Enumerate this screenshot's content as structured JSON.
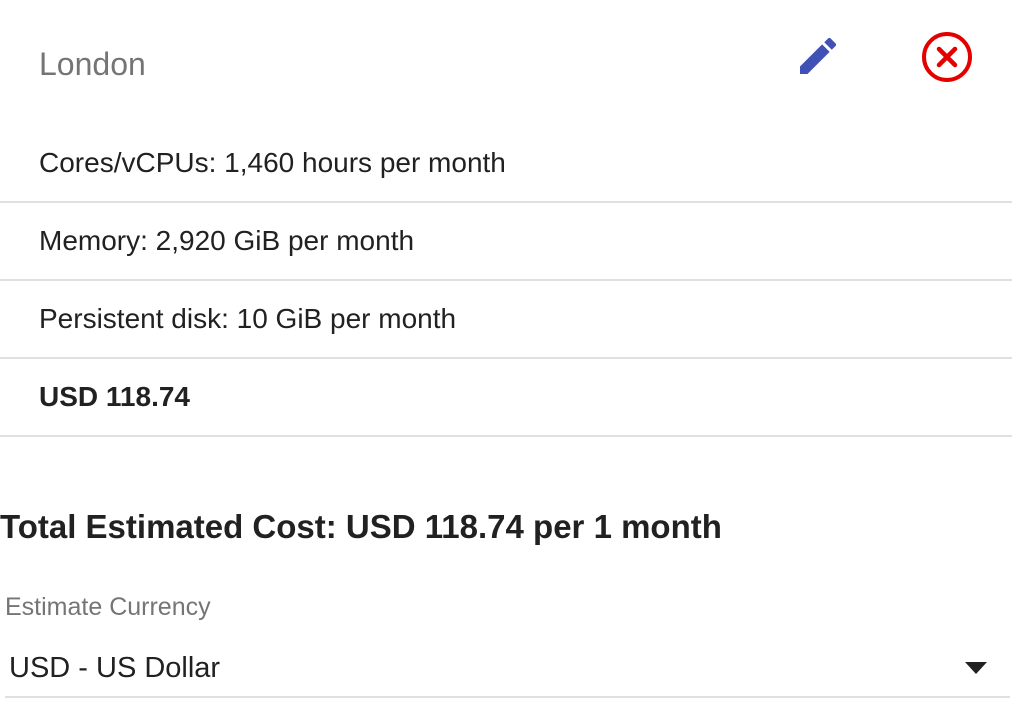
{
  "card": {
    "region": "London",
    "edit_icon": "pencil-icon",
    "remove_icon": "close-circle-icon",
    "accent_edit_color": "#3f51b5",
    "accent_remove_color": "#e50000",
    "items": [
      {
        "text": "Cores/vCPUs: 1,460 hours per month"
      },
      {
        "text": "Memory: 2,920 GiB per month"
      },
      {
        "text": "Persistent disk: 10 GiB per month"
      }
    ],
    "subtotal": "USD 118.74"
  },
  "summary": {
    "total_text": "Total Estimated Cost: USD 118.74 per 1 month"
  },
  "currency": {
    "label": "Estimate Currency",
    "selected": "USD - US Dollar"
  }
}
